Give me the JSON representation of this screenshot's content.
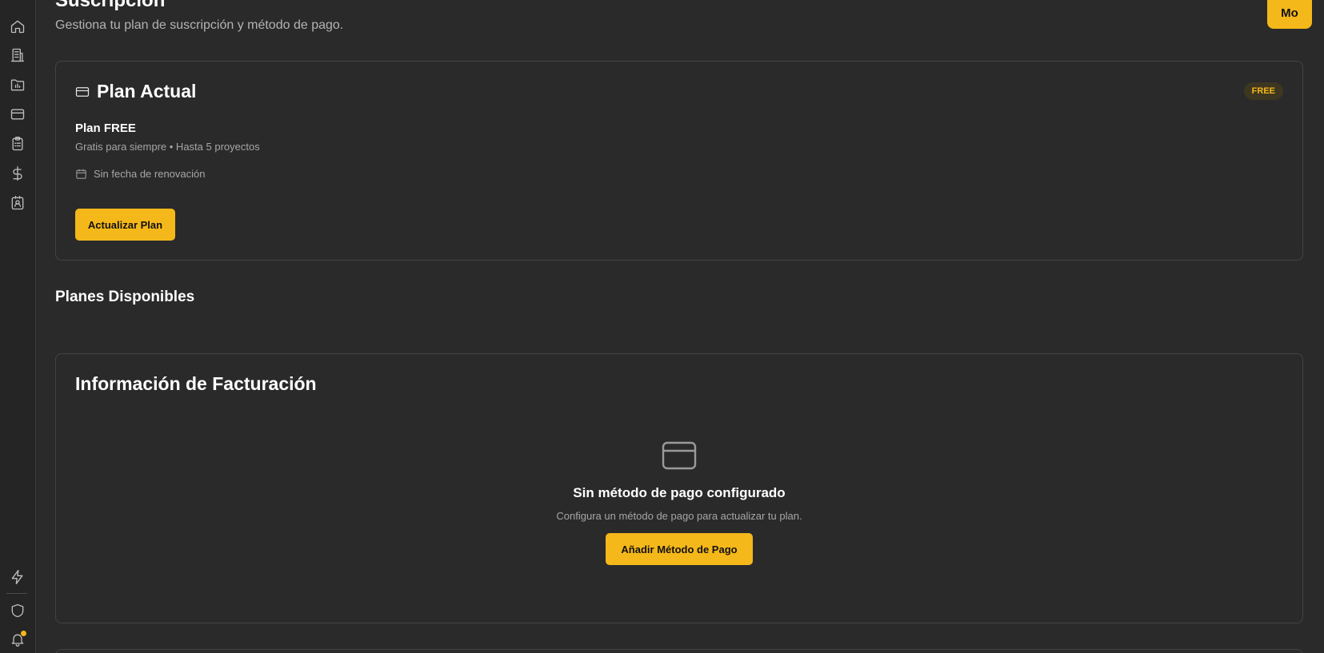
{
  "header": {
    "title": "Suscripción",
    "subtitle": "Gestiona tu plan de suscripción y método de pago.",
    "avatar_label": "Mo"
  },
  "sidebar": {
    "items": [
      {
        "icon": "home-icon"
      },
      {
        "icon": "building-icon"
      },
      {
        "icon": "folder-chart-icon"
      },
      {
        "icon": "credit-card-icon"
      },
      {
        "icon": "clipboard-list-icon"
      },
      {
        "icon": "dollar-icon"
      },
      {
        "icon": "contact-badge-icon"
      }
    ],
    "bottom_items": [
      {
        "icon": "lightning-icon"
      },
      {
        "icon": "shield-icon"
      },
      {
        "icon": "bell-icon"
      }
    ]
  },
  "current_plan": {
    "heading": "Plan Actual",
    "badge": "FREE",
    "plan_name": "Plan FREE",
    "description": "Gratis para siempre • Hasta 5 proyectos",
    "renewal": "Sin fecha de renovación",
    "upgrade_button": "Actualizar Plan"
  },
  "available_plans": {
    "title": "Planes Disponibles"
  },
  "billing": {
    "title": "Información de Facturación",
    "empty_title": "Sin método de pago configurado",
    "empty_description": "Configura un método de pago para actualizar tu plan.",
    "add_button": "Añadir Método de Pago"
  },
  "colors": {
    "accent": "#f5b81a",
    "background": "#2a2a2a",
    "sidebar": "#252525",
    "border": "#444444"
  }
}
